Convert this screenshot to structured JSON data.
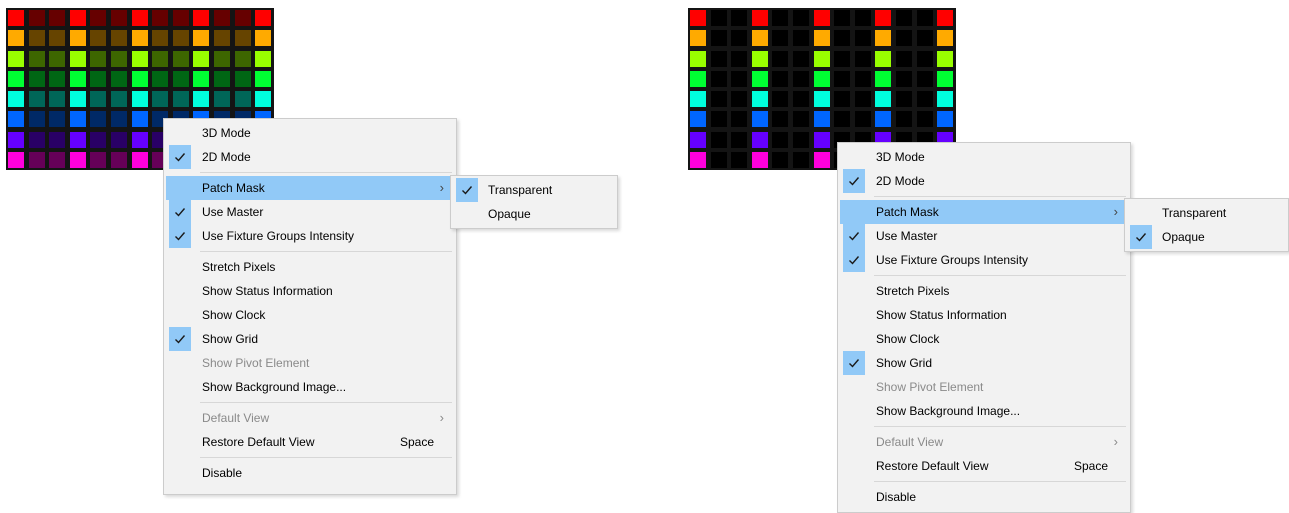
{
  "grid_colors": [
    "#ff0000",
    "#ffaa00",
    "#99ff00",
    "#00ff33",
    "#00ffdd",
    "#0066ff",
    "#6600ff",
    "#ff00dd"
  ],
  "grid_dim_colors": [
    "#660000",
    "#664400",
    "#3d6600",
    "#006614",
    "#006658",
    "#002966",
    "#290066",
    "#660058"
  ],
  "left": {
    "menu": [
      {
        "label": "3D Mode",
        "checked": false
      },
      {
        "label": "2D Mode",
        "checked": true
      },
      {
        "sep": true
      },
      {
        "label": "Patch Mask",
        "submenu": true,
        "highlight": true
      },
      {
        "label": "Use Master",
        "checked": true
      },
      {
        "label": "Use Fixture Groups Intensity",
        "checked": true
      },
      {
        "sep": true
      },
      {
        "label": "Stretch Pixels"
      },
      {
        "label": "Show Status Information"
      },
      {
        "label": "Show Clock"
      },
      {
        "label": "Show Grid",
        "checked": true
      },
      {
        "label": "Show Pivot Element",
        "disabled": true
      },
      {
        "label": "Show Background Image..."
      },
      {
        "sep": true
      },
      {
        "label": "Default View",
        "disabled": true,
        "submenu": true
      },
      {
        "label": "Restore Default View",
        "shortcut": "Space"
      },
      {
        "sep": true
      },
      {
        "label": "Disable"
      }
    ],
    "submenu": [
      {
        "label": "Transparent",
        "checked": true
      },
      {
        "label": "Opaque",
        "checked": false
      }
    ]
  },
  "right": {
    "menu": [
      {
        "label": "3D Mode",
        "checked": false
      },
      {
        "label": "2D Mode",
        "checked": true
      },
      {
        "sep": true
      },
      {
        "label": "Patch Mask",
        "submenu": true,
        "highlight": true
      },
      {
        "label": "Use Master",
        "checked": true
      },
      {
        "label": "Use Fixture Groups Intensity",
        "checked": true
      },
      {
        "sep": true
      },
      {
        "label": "Stretch Pixels"
      },
      {
        "label": "Show Status Information"
      },
      {
        "label": "Show Clock"
      },
      {
        "label": "Show Grid",
        "checked": true
      },
      {
        "label": "Show Pivot Element",
        "disabled": true
      },
      {
        "label": "Show Background Image..."
      },
      {
        "sep": true
      },
      {
        "label": "Default View",
        "disabled": true,
        "submenu": true
      },
      {
        "label": "Restore Default View",
        "shortcut": "Space"
      },
      {
        "sep": true
      },
      {
        "label": "Disable"
      }
    ],
    "submenu": [
      {
        "label": "Transparent",
        "checked": false
      },
      {
        "label": "Opaque",
        "checked": true
      }
    ]
  }
}
